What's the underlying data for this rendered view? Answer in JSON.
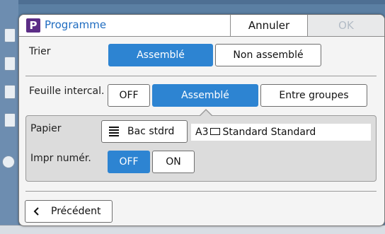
{
  "dialog": {
    "app_icon_letter": "P",
    "title": "Programme",
    "cancel_label": "Annuler",
    "ok_label": "OK",
    "ok_enabled": false
  },
  "sort": {
    "label": "Trier",
    "options": [
      "Assemblé",
      "Non assemblé"
    ],
    "selected": "Assemblé"
  },
  "separator": {
    "label": "Feuille intercal.",
    "options": [
      "OFF",
      "Assemblé",
      "Entre groupes"
    ],
    "selected": "Assemblé"
  },
  "paper": {
    "label": "Papier",
    "tray_icon": "tray-list-icon",
    "tray_label": "Bac stdrd",
    "size": "A3",
    "orientation_icon": "landscape-sheet-icon",
    "type": "Standard Standard"
  },
  "numbering": {
    "label": "Impr numér.",
    "options": [
      "OFF",
      "ON"
    ],
    "selected": "OFF"
  },
  "footer": {
    "back_label": "Précédent",
    "back_icon": "chevron-left-icon"
  },
  "colors": {
    "accent": "#2d84d2",
    "title_text": "#1f6cc0",
    "app_icon_bg": "#5b2d86",
    "ok_disabled_text": "#b3bcc6"
  }
}
